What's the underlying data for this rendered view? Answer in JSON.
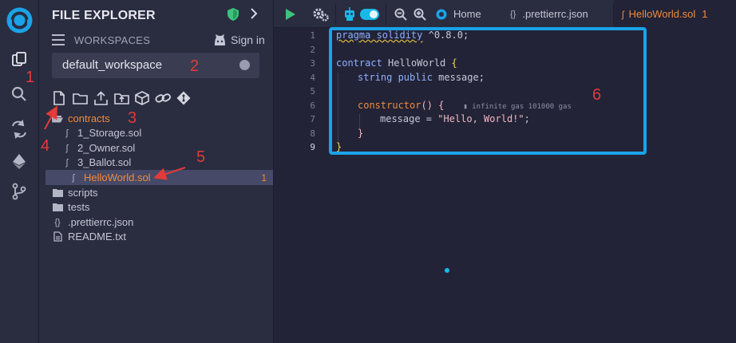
{
  "sidebar": {
    "title": "FILE EXPLORER",
    "workspaces_label": "WORKSPACES",
    "sign_in_label": "Sign in",
    "workspace_value": "default_workspace",
    "tree": [
      {
        "label": "contracts",
        "type": "folder-open",
        "indent": 0
      },
      {
        "label": "1_Storage.sol",
        "type": "sol",
        "indent": 1
      },
      {
        "label": "2_Owner.sol",
        "type": "sol",
        "indent": 1
      },
      {
        "label": "3_Ballot.sol",
        "type": "sol",
        "indent": 1
      },
      {
        "label": "HelloWorld.sol",
        "type": "sol",
        "indent": 1,
        "badge": "1"
      },
      {
        "label": "scripts",
        "type": "folder",
        "indent": 0
      },
      {
        "label": "tests",
        "type": "folder",
        "indent": 0
      },
      {
        "label": ".prettierrc.json",
        "type": "json",
        "indent": 0
      },
      {
        "label": "README.txt",
        "type": "txt",
        "indent": 0
      }
    ]
  },
  "tabs": [
    {
      "label": "Home"
    },
    {
      "label": ".prettierrc.json"
    },
    {
      "label": "HelloWorld.sol",
      "badge": "1"
    }
  ],
  "editor": {
    "line_numbers": [
      "1",
      "2",
      "3",
      "4",
      "5",
      "6",
      "7",
      "8",
      "9"
    ],
    "gas_hint": "infinite gas 101000 gas",
    "code": {
      "l1_kw": "pragma solidity",
      "l1_rest": " ^0.8.0;",
      "l3_kw": "contract",
      "l3_name": " HelloWorld ",
      "l3_brace": "{",
      "l4_type": "string",
      "l4_mod": " public",
      "l4_rest": " message;",
      "l6_kw": "constructor",
      "l6_paren": "()",
      "l6_brace": " {",
      "l7_lhs": "message = ",
      "l7_str": "\"Hello, World!\"",
      "l7_end": ";",
      "l8_brace": "}",
      "l9_brace": "}"
    }
  },
  "annotations": [
    "1",
    "2",
    "3",
    "4",
    "5",
    "6"
  ],
  "colors": {
    "accent_orange": "#f08b3c",
    "highlight_blue": "#1aa3e8",
    "annotation_red": "#e33a3a",
    "run_green": "#3cc47c",
    "toggle_cyan": "#1ab8e8"
  }
}
